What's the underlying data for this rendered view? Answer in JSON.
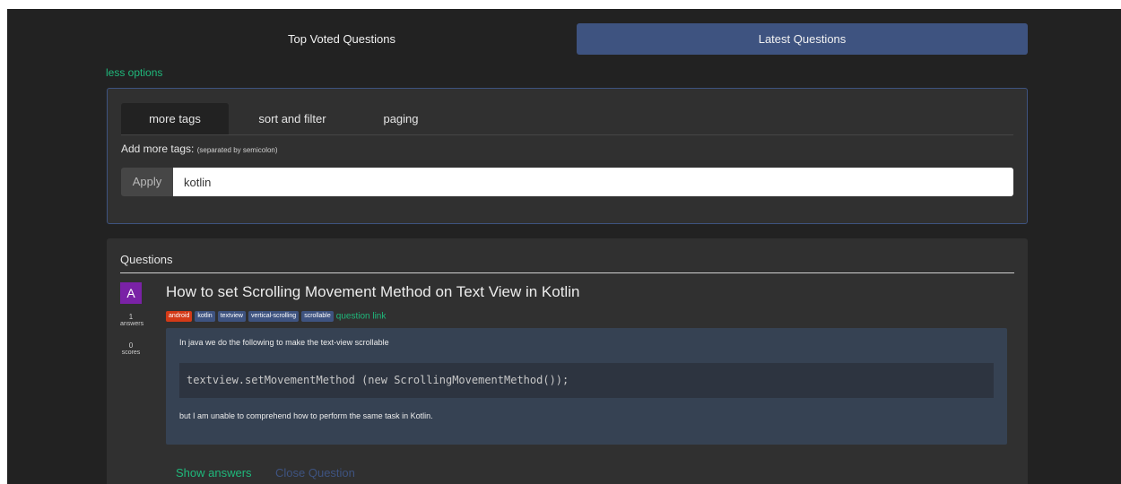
{
  "top_tabs": [
    "Top Voted Questions",
    "Latest Questions"
  ],
  "less_options": "less options",
  "options": {
    "tabs": [
      "more tags",
      "sort and filter",
      "paging"
    ],
    "add_tags_label": "Add more tags:",
    "add_tags_hint": "(separated by semicolon)",
    "apply_label": "Apply",
    "tags_value": "kotlin"
  },
  "questions": {
    "header": "Questions",
    "item": {
      "avatar_letter": "A",
      "answers_count": "1",
      "answers_label": "answers",
      "score_count": "0",
      "score_label": "scores",
      "title": "How to set Scrolling Movement Method on Text View in Kotlin",
      "tags": [
        "android",
        "kotlin",
        "textview",
        "vertical-scrolling",
        "scrollable"
      ],
      "question_link": "question link",
      "body_p1": "In java we do the following to make the text-view scrollable",
      "code": "textview.setMovementMethod (new ScrollingMovementMethod());",
      "body_p2": "but I am unable to comprehend how to perform the same task in Kotlin.",
      "show_answers": "Show answers",
      "close_question": "Close Question"
    }
  },
  "colors": {
    "accent_blue": "#3e5380",
    "accent_green": "#1fb87b",
    "tag_android": "#d33a17",
    "avatar_purple": "#7a22a6"
  }
}
